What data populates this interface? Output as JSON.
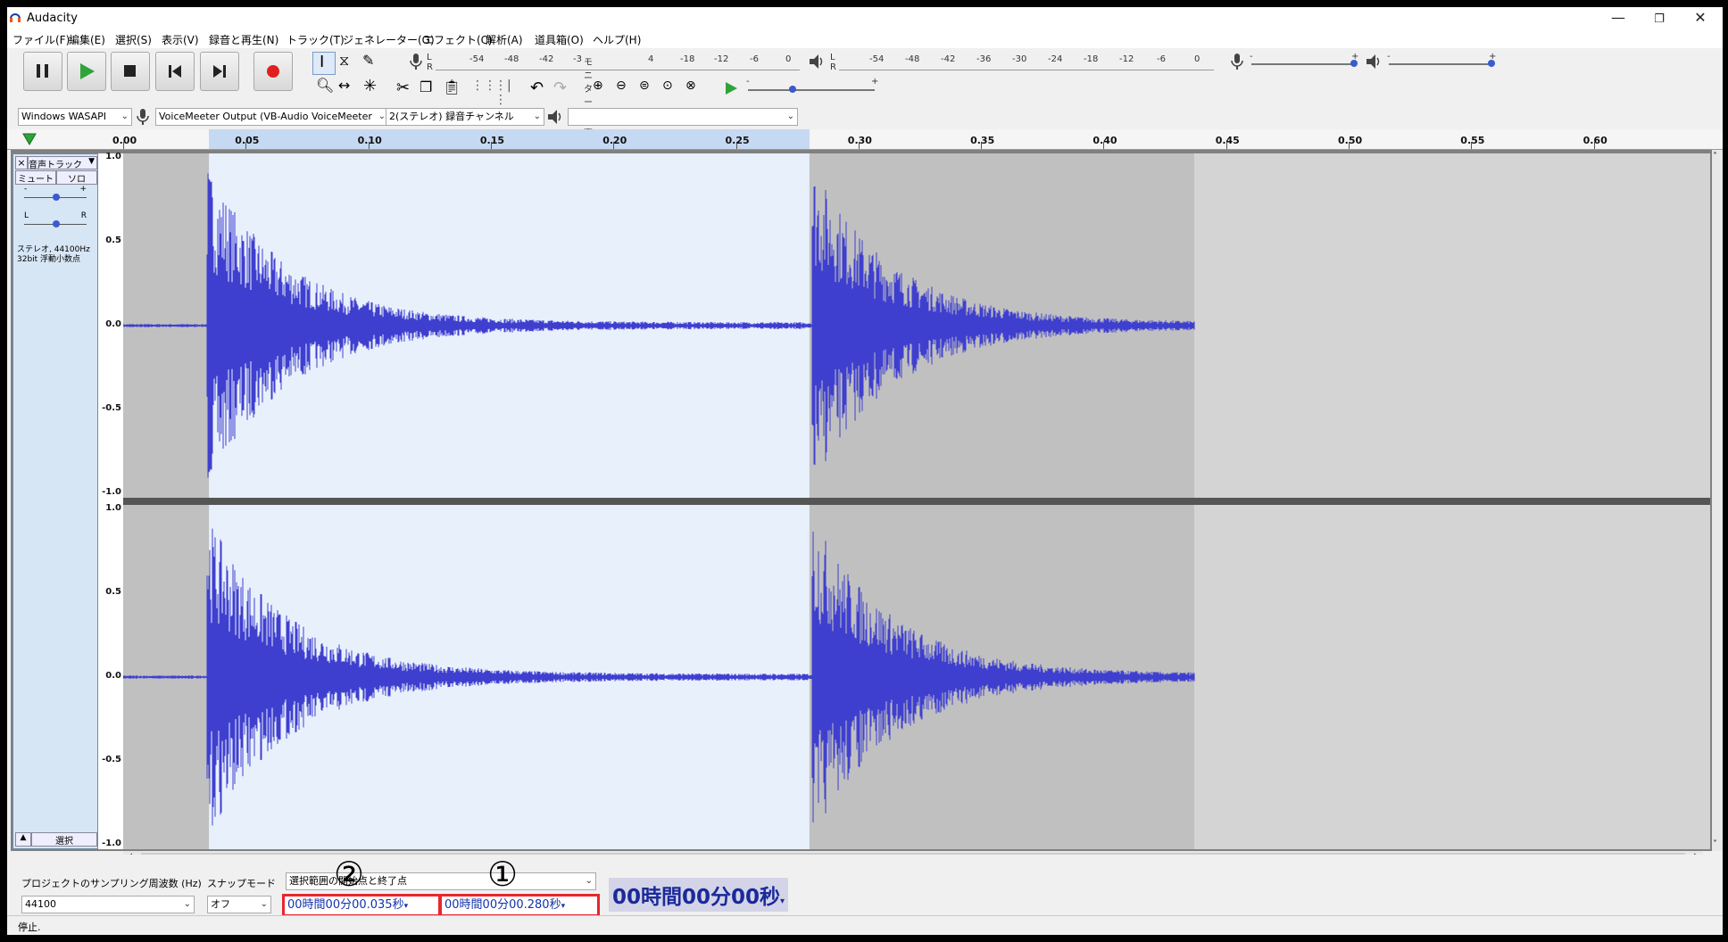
{
  "window": {
    "title": "Audacity",
    "minimize_icon": "minimize-icon",
    "restore_icon": "restore-icon",
    "close_icon": "close-icon"
  },
  "menu": [
    "ファイル(F)",
    "編集(E)",
    "選択(S)",
    "表示(V)",
    "録音と再生(N)",
    "トラック(T)",
    "ジェネレーター(G)",
    "エフェクト(C)",
    "解析(A)",
    "道具箱(O)",
    "ヘルプ(H)"
  ],
  "transport": {
    "pause": "pause-icon",
    "play": "play-icon",
    "stop": "stop-icon",
    "skip_start": "skip-start-icon",
    "skip_end": "skip-end-icon",
    "record": "record-icon"
  },
  "record_meter": {
    "ticks": [
      "-54",
      "-48",
      "-42",
      "-3",
      "モニターを開始",
      "4",
      "-18",
      "-12",
      "-6",
      "0"
    ],
    "lr": [
      "L",
      "R"
    ]
  },
  "play_meter": {
    "ticks": [
      "-54",
      "-48",
      "-42",
      "-36",
      "-30",
      "-24",
      "-18",
      "-12",
      "-6",
      "0"
    ],
    "lr": [
      "L",
      "R"
    ]
  },
  "slider_signs": {
    "minus": "-",
    "plus": "+"
  },
  "device": {
    "host": "Windows WASAPI",
    "recording_device": "VoiceMeeter Output (VB-Audio VoiceMeeter",
    "channels": "2(ステレオ) 録音チャンネル",
    "playback_device": ""
  },
  "ruler": {
    "ticks": [
      "0.00",
      "0.05",
      "0.10",
      "0.15",
      "0.20",
      "0.25",
      "0.30",
      "0.35",
      "0.40",
      "0.45",
      "0.50",
      "0.55",
      "0.60"
    ],
    "selection_start": 0.035,
    "selection_end": 0.28
  },
  "track": {
    "name": "音声トラック",
    "mute": "ミュート",
    "solo": "ソロ",
    "gain_minus": "-",
    "gain_plus": "+",
    "pan_left": "L",
    "pan_right": "R",
    "info_line1": "ステレオ, 44100Hz",
    "info_line2": "32bit 浮動小数点",
    "select": "選択",
    "close": "×",
    "collapse": "▲",
    "menu_arrow": "▼",
    "vertical_ticks": [
      "1.0",
      "0.5",
      "0.0",
      "-0.5",
      "-1.0"
    ],
    "clip_end": 0.437
  },
  "bottom": {
    "rate_label": "プロジェクトのサンプリング周波数 (Hz)",
    "rate_value": "44100",
    "snap_label": "スナップモード",
    "snap_value": "オフ",
    "selection_mode": "選択範囲の開始点と終了点",
    "start_time": "00時間00分00.035秒",
    "end_time": "00時間00分00.280秒",
    "audio_position": "00時間00分00秒",
    "marker_start": "②",
    "marker_end": "①"
  },
  "status": {
    "text": "停止."
  },
  "colors": {
    "wave": "#3f3fcf",
    "selection_bg": "#e8f0fc",
    "unselected_bg": "#c0c0c0",
    "empty_bg": "#d4d4d4",
    "highlight": "#e8262f"
  }
}
